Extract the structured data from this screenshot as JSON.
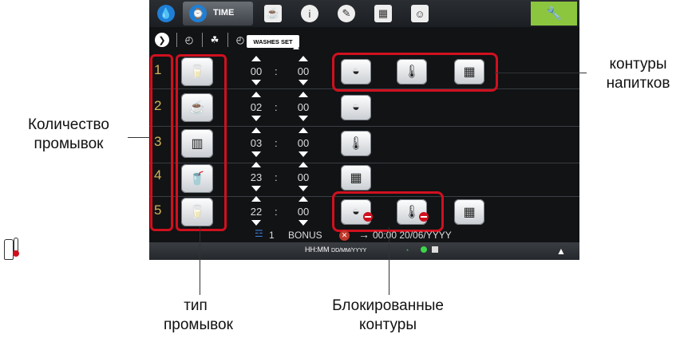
{
  "top_tabs": {
    "time_label": "TIME",
    "icons": [
      "drop-icon",
      "clock-icon",
      "cup-icon",
      "info-icon",
      "pen-icon",
      "calc-icon",
      "user-icon"
    ],
    "settings_icon": "wrench-icon"
  },
  "sub_tabs": {
    "washes_set": "WASHES SET"
  },
  "rows": [
    {
      "number": "1",
      "hours": "00",
      "minutes": "00",
      "wash_type": "milk-jug-icon"
    },
    {
      "number": "2",
      "hours": "02",
      "minutes": "00",
      "wash_type": "cup-rinse-icon"
    },
    {
      "number": "3",
      "hours": "03",
      "minutes": "00",
      "wash_type": "milk-carton-icon"
    },
    {
      "number": "4",
      "hours": "23",
      "minutes": "00",
      "wash_type": "water-glass-icon"
    },
    {
      "number": "5",
      "hours": "22",
      "minutes": "00",
      "wash_type": "milk-jug-icon"
    }
  ],
  "colon": ":",
  "status": {
    "count": "1",
    "bonus": "BONUS",
    "next": "00:00 20/06/YYYY"
  },
  "bottom_bar": {
    "clock": "HH:MM",
    "date_format": "DD/MM/YYYY"
  },
  "annotations": {
    "drink_circuits": [
      "контуры",
      "напитков"
    ],
    "wash_count": [
      "Количество",
      "промывок"
    ],
    "wash_type": [
      "тип",
      "промывок"
    ],
    "blocked": [
      "Блокированные",
      "контуры"
    ]
  },
  "colors": {
    "highlight": "#d0101e",
    "accent": "#8cc63f",
    "row_number": "#d4b25a"
  }
}
